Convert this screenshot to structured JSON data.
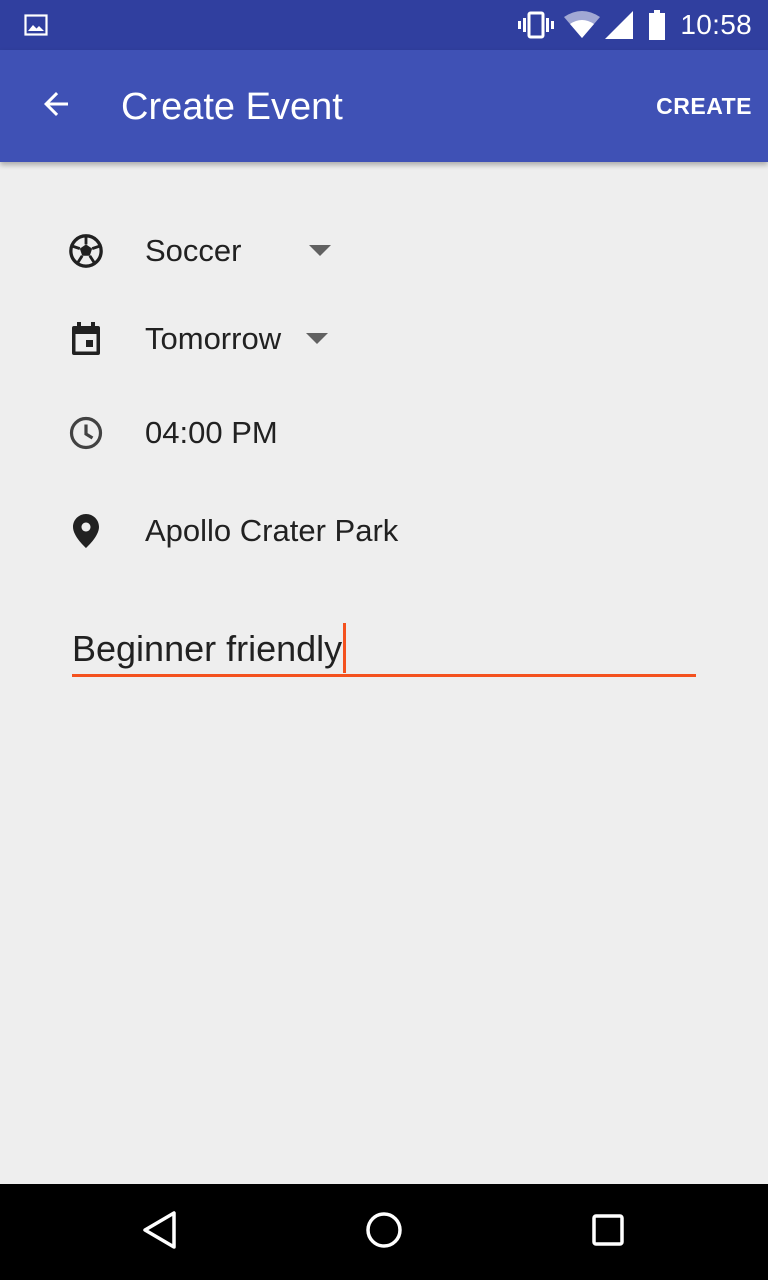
{
  "status_bar": {
    "time": "10:58",
    "icons": [
      "image-icon",
      "vibrate-icon",
      "wifi-icon",
      "cellular-signal-icon",
      "battery-icon"
    ]
  },
  "app_bar": {
    "title": "Create Event",
    "action_label": "CREATE",
    "back_icon": "arrow-back-icon"
  },
  "form": {
    "sport": {
      "value": "Soccer",
      "icon": "soccer-ball-icon"
    },
    "date": {
      "value": "Tomorrow",
      "icon": "calendar-icon"
    },
    "time": {
      "value": "04:00 PM",
      "icon": "clock-icon"
    },
    "location": {
      "value": "Apollo Crater Park",
      "icon": "location-pin-icon"
    },
    "note": {
      "value": "Beginner friendly"
    }
  },
  "nav_bar": {
    "icons": [
      "back-triangle-icon",
      "home-circle-icon",
      "recents-square-icon"
    ]
  },
  "colors": {
    "status_bar": "#303F9F",
    "app_bar": "#3F51B5",
    "background": "#EEEEEE",
    "accent": "#F4511E",
    "nav_bar": "#000000"
  }
}
